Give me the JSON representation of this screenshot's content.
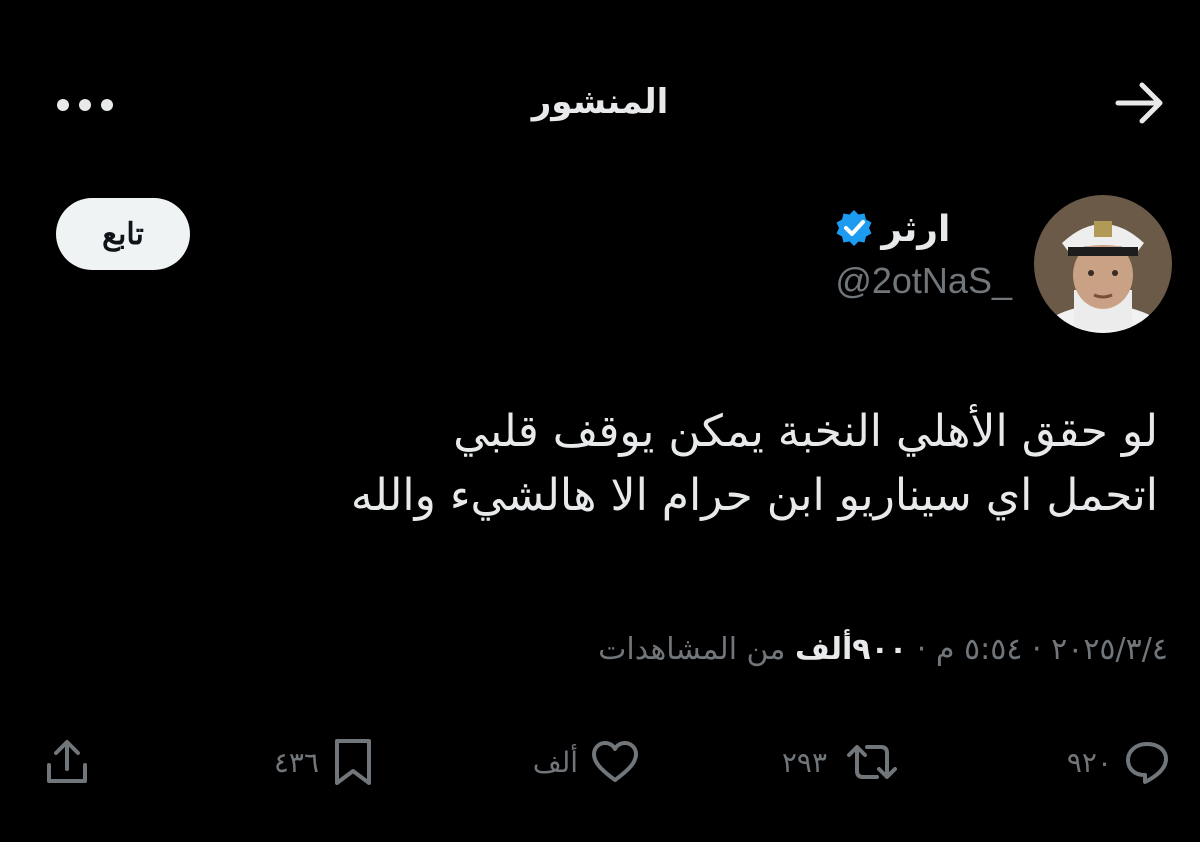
{
  "header": {
    "title": "المنشور",
    "back_icon": "arrow-right-icon",
    "more_icon": "more-dots-icon"
  },
  "author": {
    "display_name": "ارثر",
    "handle": "@2otNaS_",
    "verified_color": "#1d9bf0",
    "follow_label": "تابع"
  },
  "tweet": {
    "lines": [
      "لو حقق الأهلي النخبة يمكن يوقف قلبي",
      "اتحمل اي سيناريو ابن حرام الا هالشيء والله"
    ],
    "time": "٥:٥٤ م",
    "date": "٢٠٢٥/٣/٤",
    "views_count": "٩٠٠ألف",
    "views_label": "من المشاهدات",
    "separator": "·"
  },
  "actions": {
    "replies": "٩٢٠",
    "reposts": "٢٩٣",
    "likes": "ألف",
    "bookmarks": "٤٣٦"
  },
  "colors": {
    "background": "#000000",
    "text": "#e7e9ea",
    "secondary": "#71767b",
    "accent": "#1d9bf0"
  }
}
